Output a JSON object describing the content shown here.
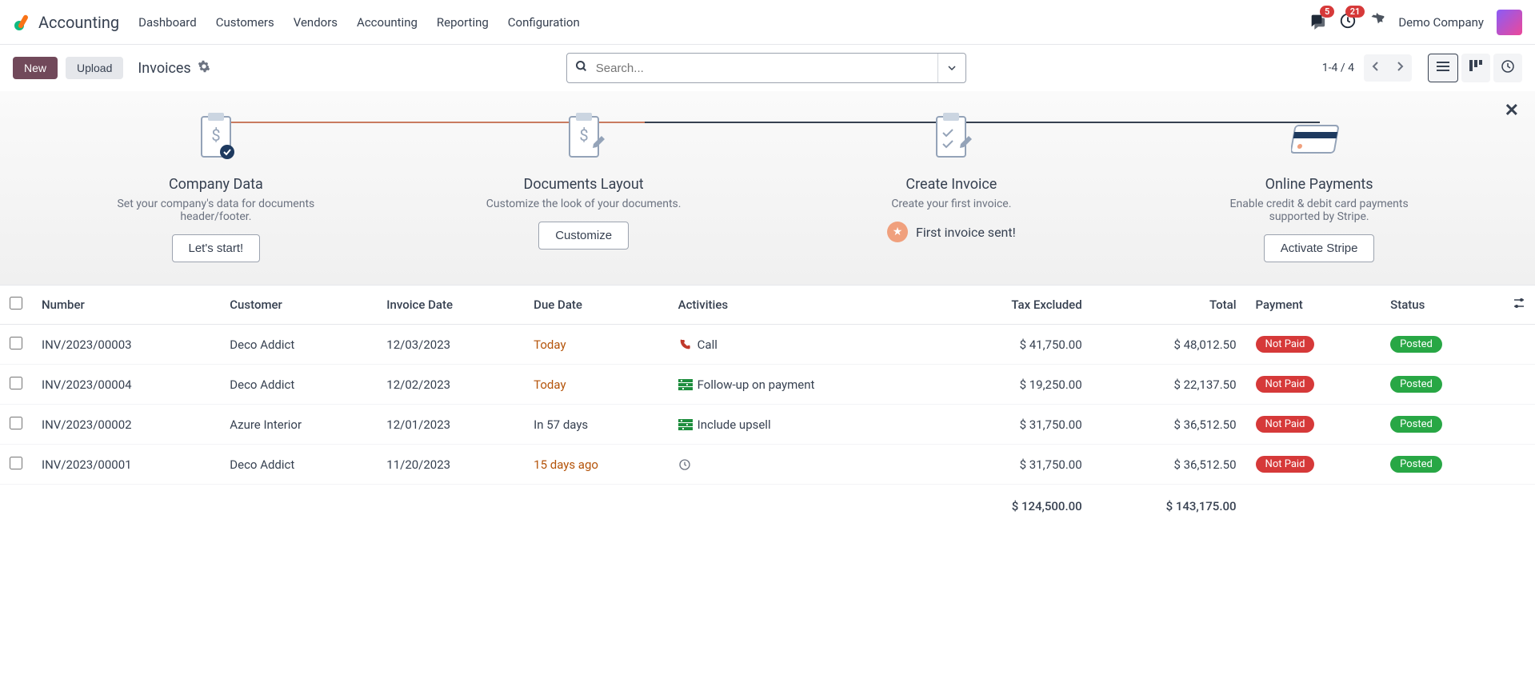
{
  "app": {
    "name": "Accounting"
  },
  "nav": {
    "items": [
      "Dashboard",
      "Customers",
      "Vendors",
      "Accounting",
      "Reporting",
      "Configuration"
    ],
    "messages_badge": "5",
    "activities_badge": "21",
    "company": "Demo Company"
  },
  "toolbar": {
    "new_label": "New",
    "upload_label": "Upload",
    "breadcrumb": "Invoices",
    "search_placeholder": "Search...",
    "pager": "1-4 / 4"
  },
  "onboarding": {
    "steps": [
      {
        "title": "Company Data",
        "desc": "Set your company's data for documents header/footer.",
        "action": "Let's start!"
      },
      {
        "title": "Documents Layout",
        "desc": "Customize the look of your documents.",
        "action": "Customize"
      },
      {
        "title": "Create Invoice",
        "desc": "Create your first invoice.",
        "done_text": "First invoice sent!"
      },
      {
        "title": "Online Payments",
        "desc": "Enable credit & debit card payments supported by Stripe.",
        "action": "Activate Stripe"
      }
    ]
  },
  "table": {
    "headers": {
      "number": "Number",
      "customer": "Customer",
      "invoice_date": "Invoice Date",
      "due_date": "Due Date",
      "activities": "Activities",
      "tax_excluded": "Tax Excluded",
      "total": "Total",
      "payment": "Payment",
      "status": "Status"
    },
    "rows": [
      {
        "number": "INV/2023/00003",
        "customer": "Deco Addict",
        "invoice_date": "12/03/2023",
        "due_date": "Today",
        "due_overdue": true,
        "activity_icon": "phone",
        "activity": "Call",
        "tax_excluded": "$ 41,750.00",
        "total": "$ 48,012.50",
        "payment": "Not Paid",
        "status": "Posted"
      },
      {
        "number": "INV/2023/00004",
        "customer": "Deco Addict",
        "invoice_date": "12/02/2023",
        "due_date": "Today",
        "due_overdue": true,
        "activity_icon": "doc",
        "activity": "Follow-up on payment",
        "tax_excluded": "$ 19,250.00",
        "total": "$ 22,137.50",
        "payment": "Not Paid",
        "status": "Posted"
      },
      {
        "number": "INV/2023/00002",
        "customer": "Azure Interior",
        "invoice_date": "12/01/2023",
        "due_date": "In 57 days",
        "due_overdue": false,
        "activity_icon": "doc",
        "activity": "Include upsell",
        "tax_excluded": "$ 31,750.00",
        "total": "$ 36,512.50",
        "payment": "Not Paid",
        "status": "Posted"
      },
      {
        "number": "INV/2023/00001",
        "customer": "Deco Addict",
        "invoice_date": "11/20/2023",
        "due_date": "15 days ago",
        "due_overdue": true,
        "activity_icon": "clock",
        "activity": "",
        "tax_excluded": "$ 31,750.00",
        "total": "$ 36,512.50",
        "payment": "Not Paid",
        "status": "Posted"
      }
    ],
    "totals": {
      "tax_excluded": "$ 124,500.00",
      "total": "$ 143,175.00"
    }
  }
}
